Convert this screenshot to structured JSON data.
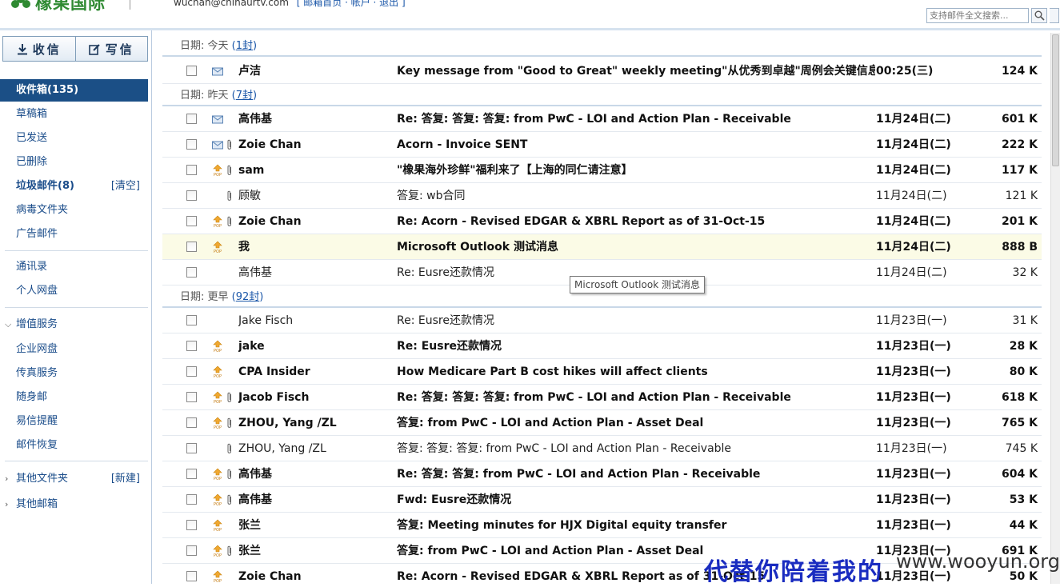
{
  "header": {
    "logo_text": "橡果国际",
    "account_email": "wuchan@chinaurtv.com",
    "account_links": "[ 邮箱首页 · 帐户 · 退出 ]",
    "search_placeholder": "支持邮件全文搜索..."
  },
  "sidebar": {
    "receive_label": "收信",
    "compose_label": "写信",
    "folders": [
      {
        "label": "收件箱(135)"
      },
      {
        "label": "草稿箱"
      },
      {
        "label": "已发送"
      },
      {
        "label": "已删除"
      },
      {
        "label": "垃圾邮件(8)",
        "action": "[清空]"
      },
      {
        "label": "病毒文件夹"
      },
      {
        "label": "广告邮件"
      },
      {
        "label": "通讯录"
      },
      {
        "label": "个人网盘"
      },
      {
        "label": "增值服务"
      },
      {
        "label": "企业网盘"
      },
      {
        "label": "传真服务"
      },
      {
        "label": "随身邮"
      },
      {
        "label": "易信提醒"
      },
      {
        "label": "邮件恢复"
      },
      {
        "label": "其他文件夹",
        "action": "[新建]"
      },
      {
        "label": "其他邮箱"
      }
    ]
  },
  "groups": [
    {
      "label": "日期: 今天",
      "count": "1封"
    },
    {
      "label": "日期: 昨天",
      "count": "7封"
    },
    {
      "label": "日期: 更早",
      "count": "92封"
    }
  ],
  "messages": [
    {
      "sender": "卢洁",
      "subject": "Key message from \"Good to Great\" weekly meeting\"从优秀到卓越\"周例会关键信息",
      "date": "00:25(三)",
      "size": "124 K"
    },
    {
      "sender": "高伟基",
      "subject": "Re: 答复: 答复: 答复: from PwC - LOI and Action Plan - Receivable",
      "date": "11月24日(二)",
      "size": "601 K"
    },
    {
      "sender": "Zoie Chan",
      "subject": "Acorn - Invoice SENT",
      "date": "11月24日(二)",
      "size": "222 K"
    },
    {
      "sender": "sam",
      "subject": "\"橡果海外珍鲜\"福利来了【上海的同仁请注意】",
      "date": "11月24日(二)",
      "size": "117 K"
    },
    {
      "sender": "顾敏",
      "subject": "答复: wb合同",
      "date": "11月24日(二)",
      "size": "121 K"
    },
    {
      "sender": "Zoie Chan",
      "subject": "Re: Acorn - Revised EDGAR & XBRL Report as of 31-Oct-15",
      "date": "11月24日(二)",
      "size": "201 K"
    },
    {
      "sender": "我",
      "subject": "Microsoft Outlook 测试消息",
      "date": "11月24日(二)",
      "size": "888 B"
    },
    {
      "sender": "高伟基",
      "subject": "Re: Eusre还款情况",
      "date": "11月24日(二)",
      "size": "32 K"
    },
    {
      "sender": "Jake Fisch",
      "subject": "Re: Eusre还款情况",
      "date": "11月23日(一)",
      "size": "31 K"
    },
    {
      "sender": "jake",
      "subject": "Re: Eusre还款情况",
      "date": "11月23日(一)",
      "size": "28 K"
    },
    {
      "sender": "CPA Insider",
      "subject": "How Medicare Part B cost hikes will affect clients",
      "date": "11月23日(一)",
      "size": "80 K"
    },
    {
      "sender": "Jacob Fisch",
      "subject": "Re: 答复: 答复: 答复: from PwC - LOI and Action Plan - Receivable",
      "date": "11月23日(一)",
      "size": "618 K"
    },
    {
      "sender": "ZHOU, Yang /ZL",
      "subject": "答复: from PwC - LOI and Action Plan - Asset Deal",
      "date": "11月23日(一)",
      "size": "765 K"
    },
    {
      "sender": "ZHOU, Yang /ZL",
      "subject": "答复: 答复: 答复: from PwC - LOI and Action Plan - Receivable",
      "date": "11月23日(一)",
      "size": "745 K"
    },
    {
      "sender": "高伟基",
      "subject": "Re: 答复: 答复: from PwC - LOI and Action Plan - Receivable",
      "date": "11月23日(一)",
      "size": "604 K"
    },
    {
      "sender": "高伟基",
      "subject": "Fwd: Eusre还款情况",
      "date": "11月23日(一)",
      "size": "53 K"
    },
    {
      "sender": "张兰",
      "subject": "答复: Meeting minutes for HJX Digital equity transfer",
      "date": "11月23日(一)",
      "size": "44 K"
    },
    {
      "sender": "张兰",
      "subject": "答复: from PwC - LOI and Action Plan - Asset Deal",
      "date": "11月23日(一)",
      "size": "691 K"
    },
    {
      "sender": "Zoie Chan",
      "subject": "Re: Acorn - Revised EDGAR & XBRL Report as of 31-Oct-15",
      "date": "11月23日(一)",
      "size": "50 K"
    }
  ],
  "tooltip": "Microsoft Outlook 测试消息",
  "watermark": {
    "cn": "代替你陪着我的",
    "site": "www.wooyun.org"
  },
  "colors": {
    "accent": "#1b4f86",
    "link": "#1a56a8",
    "highlight_row": "#fbfbe6",
    "logo": "#2f8a32"
  },
  "icons": {
    "unread": "envelope-icon",
    "pop": "pop-mail-icon",
    "attachment": "paperclip-icon"
  }
}
